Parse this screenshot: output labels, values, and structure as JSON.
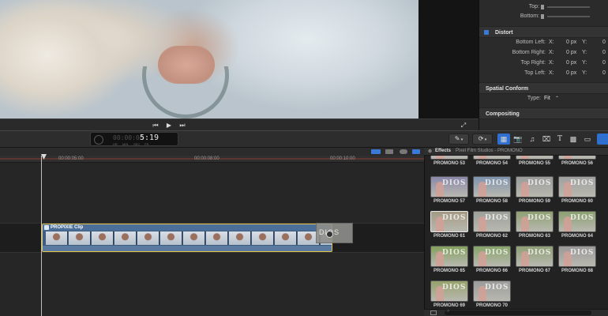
{
  "inspector": {
    "top_label": "Top:",
    "bottom_label": "Bottom:",
    "distort": {
      "title": "Distort",
      "rows": [
        {
          "label": "Bottom Left:",
          "x_label": "X:",
          "x_value": "0 px",
          "y_label": "Y:",
          "y_value": "0"
        },
        {
          "label": "Bottom Right:",
          "x_label": "X:",
          "x_value": "0 px",
          "y_label": "Y:",
          "y_value": "0"
        },
        {
          "label": "Top Right:",
          "x_label": "X:",
          "x_value": "0 px",
          "y_label": "Y:",
          "y_value": "0"
        },
        {
          "label": "Top Left:",
          "x_label": "X:",
          "x_value": "0 px",
          "y_label": "Y:",
          "y_value": "0"
        }
      ]
    },
    "spatial_conform": {
      "title": "Spatial Conform",
      "type_label": "Type:",
      "type_value": "Fit"
    },
    "compositing": {
      "title": "Compositing"
    }
  },
  "viewer": {
    "transport": {
      "prev_icon": "⏮",
      "play_icon": "▶",
      "next_icon": "⏭",
      "fullscreen_icon": "⤢"
    }
  },
  "toolbar": {
    "timecode": "5:19",
    "timecode_lead": "00:00:00",
    "timecode_units": [
      "HR",
      "MIN",
      "SEC",
      "FR"
    ],
    "tool_icon": "✎",
    "speed_icon": "⟳",
    "browser_icons": [
      "▦",
      "📷",
      "♫",
      "⌧",
      "T",
      "▩",
      "▭"
    ]
  },
  "timeline": {
    "ruler_labels": [
      "00:00:05:00",
      "00:00:08:00",
      "00:00:10:00"
    ],
    "clip_title": "PROPIXIE Clip",
    "drag_ghost_text": "DIOS"
  },
  "effects": {
    "header_title": "Effects",
    "header_subtitle": "Pixel Film Studios - PROMONO",
    "search_placeholder": "",
    "partial_row": [
      "PROMONO 53",
      "PROMONO 54",
      "PROMONO 55",
      "PROMONO 56"
    ],
    "items": [
      "PROMONO 57",
      "PROMONO 58",
      "PROMONO 59",
      "PROMONO 60",
      "PROMONO 61",
      "PROMONO 62",
      "PROMONO 63",
      "PROMONO 64",
      "PROMONO 65",
      "PROMONO 66",
      "PROMONO 67",
      "PROMONO 68",
      "PROMONO 69",
      "PROMONO 70"
    ],
    "thumb_watermark": "DIOS",
    "thumb_tints": [
      "#8a87a8",
      "#7f93ad",
      "#9a9a9a",
      "#9f9f9f",
      "#a39a83",
      "#9da09a",
      "#8fa072",
      "#8ca071",
      "#84a05e",
      "#87a36a",
      "#8f9f76",
      "#9a9898",
      "#96a16b",
      "#9b9b9b"
    ],
    "partial_tints": [
      "#8a87a8",
      "#a0a09a",
      "#9d9a93",
      "#8fa6a0"
    ]
  }
}
